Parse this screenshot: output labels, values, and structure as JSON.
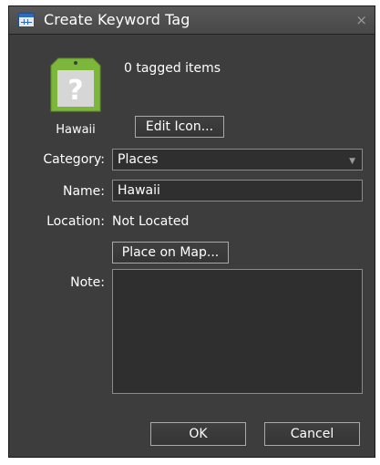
{
  "window": {
    "title": "Create Keyword Tag",
    "close_glyph": "×"
  },
  "tag": {
    "icon_name": "question-tag-icon",
    "icon_glyph": "?",
    "name": "Hawaii",
    "tagged_count_text": "0 tagged items",
    "edit_icon_label": "Edit Icon..."
  },
  "form": {
    "category_label": "Category:",
    "category_value": "Places",
    "name_label": "Name:",
    "name_value": "Hawaii",
    "location_label": "Location:",
    "location_value": "Not Located",
    "place_on_map_label": "Place on Map...",
    "note_label": "Note:",
    "note_value": ""
  },
  "buttons": {
    "ok": "OK",
    "cancel": "Cancel"
  },
  "colors": {
    "dialog_bg": "#3d3d3d",
    "tag_green": "#7cb63a",
    "text": "#ffffff"
  }
}
